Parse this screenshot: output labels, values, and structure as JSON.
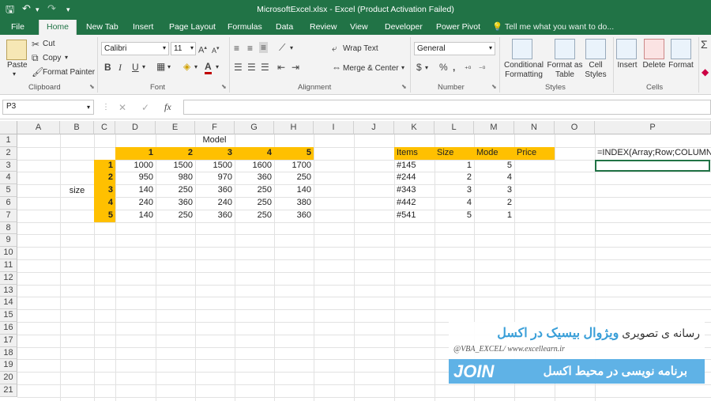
{
  "window": {
    "title": "MicrosoftExcel.xlsx - Excel (Product Activation Failed)"
  },
  "tabs": [
    "File",
    "Home",
    "New Tab",
    "Insert",
    "Page Layout",
    "Formulas",
    "Data",
    "Review",
    "View",
    "Developer",
    "Power Pivot"
  ],
  "tell_me": "Tell me what you want to do...",
  "ribbon": {
    "clipboard": {
      "paste": "Paste",
      "cut": "Cut",
      "copy": "Copy",
      "format_painter": "Format Painter",
      "label": "Clipboard"
    },
    "font": {
      "name": "Calibri",
      "size": "11",
      "label": "Font",
      "bold": "B",
      "italic": "I",
      "underline": "U"
    },
    "alignment": {
      "wrap": "Wrap Text",
      "merge": "Merge & Center",
      "label": "Alignment"
    },
    "number": {
      "format": "General",
      "label": "Number",
      "percent": "%",
      "comma": ","
    },
    "styles": {
      "conditional": "Conditional",
      "formatting": "Formatting",
      "format_as": "Format as",
      "table": "Table",
      "cell": "Cell",
      "styles": "Styles",
      "label": "Styles"
    },
    "cells": {
      "insert": "Insert",
      "delete": "Delete",
      "format": "Format",
      "label": "Cells"
    }
  },
  "formula_bar": {
    "name_box": "P3",
    "fx": "fx",
    "cancel": "✕",
    "enter": "✓",
    "value": ""
  },
  "columns": [
    "A",
    "B",
    "C",
    "D",
    "E",
    "F",
    "G",
    "H",
    "I",
    "J",
    "K",
    "L",
    "M",
    "N",
    "O",
    "P"
  ],
  "rows": [
    "1",
    "2",
    "3",
    "4",
    "5",
    "6",
    "7",
    "8",
    "9",
    "10",
    "11",
    "12",
    "13",
    "14",
    "15",
    "16",
    "17",
    "18",
    "19",
    "20",
    "21"
  ],
  "sheet": {
    "model_label": "Model",
    "size_label": "size",
    "model_headers": [
      "1",
      "2",
      "3",
      "4",
      "5"
    ],
    "size_headers": [
      "1",
      "2",
      "3",
      "4",
      "5"
    ],
    "matrix": [
      [
        "1000",
        "1500",
        "1500",
        "1600",
        "1700"
      ],
      [
        "950",
        "980",
        "970",
        "360",
        "250"
      ],
      [
        "140",
        "250",
        "360",
        "250",
        "140"
      ],
      [
        "240",
        "360",
        "240",
        "250",
        "380"
      ],
      [
        "140",
        "250",
        "360",
        "250",
        "360"
      ]
    ],
    "table_headers": [
      "Items",
      "Size",
      "Mode",
      "Price"
    ],
    "table_rows": [
      [
        "#145",
        "1",
        "5"
      ],
      [
        "#244",
        "2",
        "4"
      ],
      [
        "#343",
        "3",
        "3"
      ],
      [
        "#442",
        "4",
        "2"
      ],
      [
        "#541",
        "5",
        "1"
      ]
    ],
    "formula_note": "=INDEX(Array;Row;COLUMN)"
  },
  "banner": {
    "line1": "رسانه ی تصویری",
    "line1b": "ویژوال بیسیک در اکسل",
    "handle": "@VBA_EXCEL/ www.excellearn.ir",
    "join": "JOIN",
    "line2": "برنامه نویسی در محیط اکسل"
  },
  "colors": {
    "excel_green": "#217346",
    "highlight": "#ffc000",
    "banner_blue": "#5fb2e6"
  }
}
